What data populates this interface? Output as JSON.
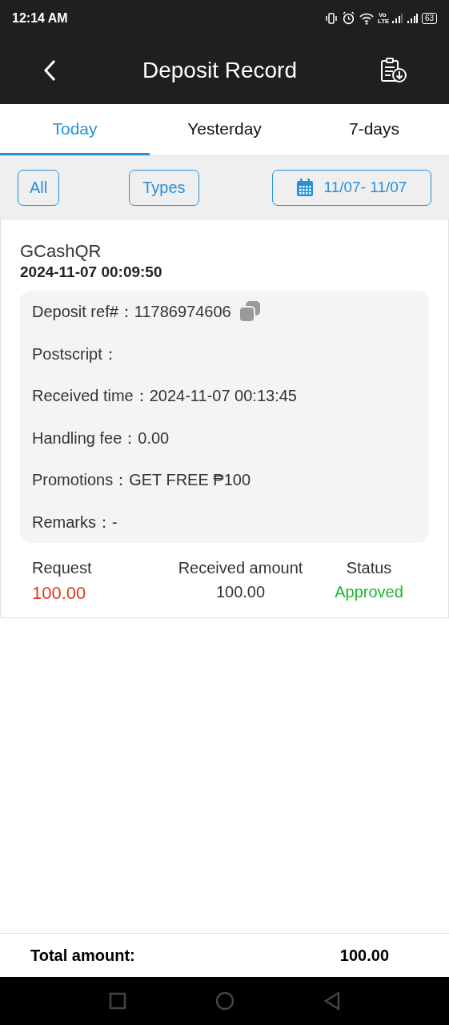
{
  "status_bar": {
    "time": "12:14 AM",
    "network": "Vo LTE",
    "battery": "63"
  },
  "header": {
    "title": "Deposit Record"
  },
  "tabs": [
    {
      "label": "Today",
      "selected": true
    },
    {
      "label": "Yesterday",
      "selected": false
    },
    {
      "label": "7-days",
      "selected": false
    }
  ],
  "filters": {
    "all": "All",
    "types": "Types",
    "date_range": "11/07- 11/07"
  },
  "records": [
    {
      "method": "GCashQR",
      "time": "2024-11-07 00:09:50",
      "details": [
        {
          "text": "Deposit ref#：11786974606",
          "kind": "copyable"
        },
        {
          "text": "Postscript：",
          "kind": "plain"
        },
        {
          "text": "Received time：2024-11-07 00:13:45",
          "kind": "plain"
        },
        {
          "text": "Handling fee：0.00",
          "kind": "plain"
        },
        {
          "text": "Promotions：GET FREE ₱100",
          "kind": "plain"
        },
        {
          "text": "Remarks：-",
          "kind": "plain"
        }
      ],
      "request_label": "Request",
      "request": "100.00",
      "received_label": "Received amount",
      "received": "100.00",
      "status_label": "Status",
      "status": {
        "text": "Approved",
        "kind": "approved"
      }
    }
  ],
  "total": {
    "label": "Total amount:",
    "value": "100.00"
  }
}
